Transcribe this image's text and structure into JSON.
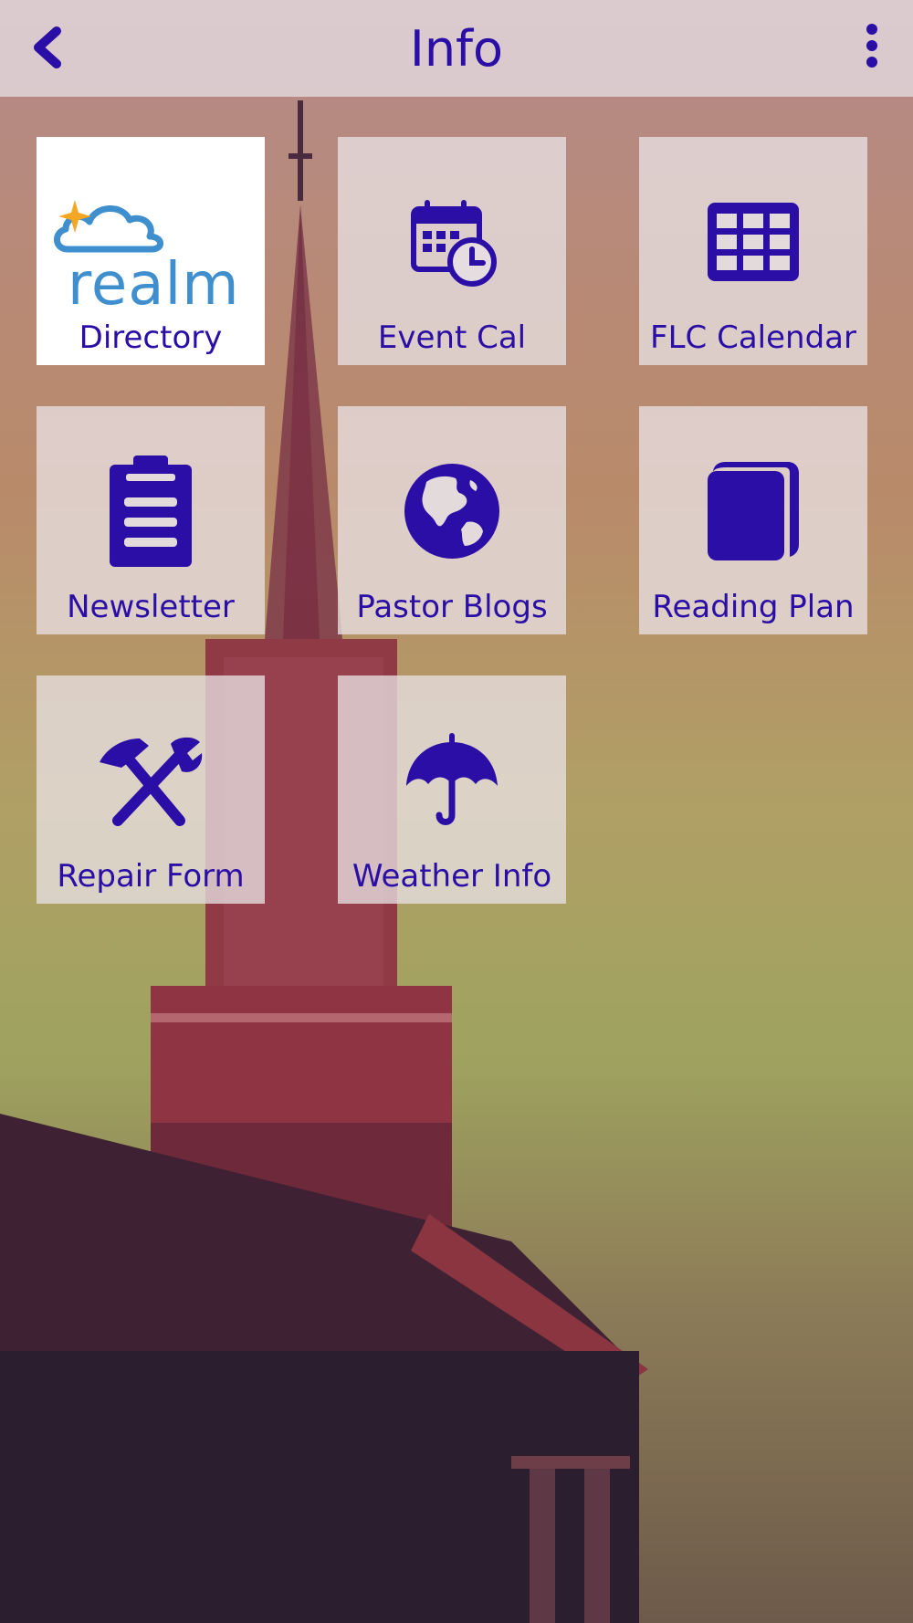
{
  "header": {
    "title": "Info",
    "back_icon": "chevron-left-icon",
    "menu_icon": "more-vertical-icon"
  },
  "tiles": [
    {
      "label": "Directory",
      "icon": "realm-logo",
      "logo_text": "realm"
    },
    {
      "label": "Event Cal",
      "icon": "calendar-clock-icon"
    },
    {
      "label": "FLC Calendar",
      "icon": "calendar-grid-icon"
    },
    {
      "label": "Newsletter",
      "icon": "clipboard-icon"
    },
    {
      "label": "Pastor Blogs",
      "icon": "globe-icon"
    },
    {
      "label": "Reading Plan",
      "icon": "book-icon"
    },
    {
      "label": "Repair Form",
      "icon": "hammer-wrench-icon"
    },
    {
      "label": "Weather Info",
      "icon": "umbrella-icon"
    }
  ],
  "colors": {
    "accent": "#2a0ea6",
    "realm_blue": "#3f8fcf",
    "realm_star": "#f5a623"
  }
}
